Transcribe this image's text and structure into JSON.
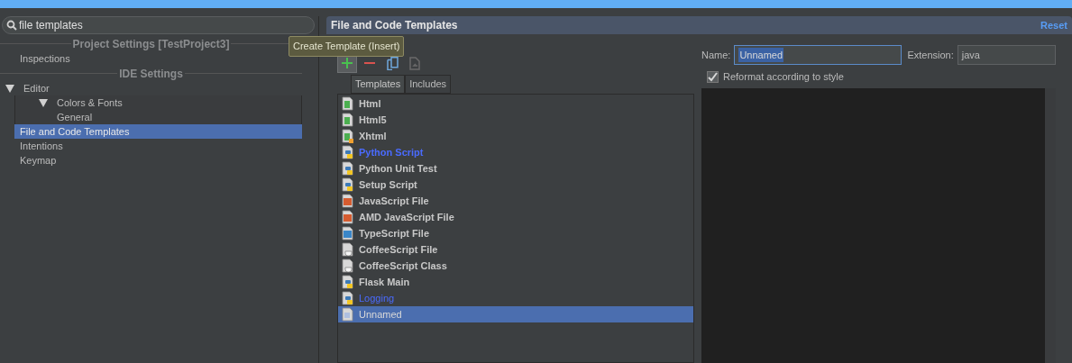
{
  "sidebar": {
    "search": {
      "value": "file templates"
    },
    "sections": [
      {
        "title": "Project Settings [TestProject3]",
        "items": [
          {
            "label": "Inspections",
            "selected": false
          }
        ]
      },
      {
        "title": "IDE Settings",
        "items": [
          {
            "label": "Editor",
            "selected": false,
            "expanded": true,
            "children": [
              {
                "label": "Colors & Fonts",
                "selected": false,
                "expanded": true,
                "children": [
                  {
                    "label": "General",
                    "selected": false
                  }
                ]
              }
            ]
          },
          {
            "label": "File and Code Templates",
            "selected": true
          },
          {
            "label": "Intentions",
            "selected": false
          },
          {
            "label": "Keymap",
            "selected": false
          }
        ]
      }
    ]
  },
  "panel": {
    "title": "File and Code Templates",
    "reset": "Reset",
    "tooltip": "Create Template (Insert)",
    "toolbar": [
      {
        "kind": "add",
        "disabled": false
      },
      {
        "kind": "remove",
        "disabled": false
      },
      {
        "kind": "copy",
        "disabled": false
      },
      {
        "kind": "revert",
        "disabled": true
      }
    ],
    "tabs": [
      {
        "label": "Templates",
        "selected": true
      },
      {
        "label": "Includes",
        "selected": false
      }
    ],
    "templates": [
      {
        "label": "Html",
        "kind": "html",
        "builtin": true,
        "modified": false,
        "selected": false
      },
      {
        "label": "Html5",
        "kind": "html",
        "builtin": true,
        "modified": false,
        "selected": false
      },
      {
        "label": "Xhtml",
        "kind": "xhtml",
        "builtin": true,
        "modified": false,
        "selected": false
      },
      {
        "label": "Python Script",
        "kind": "python",
        "builtin": true,
        "modified": true,
        "selected": false
      },
      {
        "label": "Python Unit Test",
        "kind": "python",
        "builtin": true,
        "modified": false,
        "selected": false
      },
      {
        "label": "Setup Script",
        "kind": "python",
        "builtin": true,
        "modified": false,
        "selected": false
      },
      {
        "label": "JavaScript File",
        "kind": "js",
        "builtin": true,
        "modified": false,
        "selected": false
      },
      {
        "label": "AMD JavaScript File",
        "kind": "js",
        "builtin": true,
        "modified": false,
        "selected": false
      },
      {
        "label": "TypeScript File",
        "kind": "ts",
        "builtin": true,
        "modified": false,
        "selected": false
      },
      {
        "label": "CoffeeScript File",
        "kind": "coffee",
        "builtin": true,
        "modified": false,
        "selected": false
      },
      {
        "label": "CoffeeScript Class",
        "kind": "coffee",
        "builtin": true,
        "modified": false,
        "selected": false
      },
      {
        "label": "Flask Main",
        "kind": "python",
        "builtin": true,
        "modified": false,
        "selected": false
      },
      {
        "label": "Logging",
        "kind": "python",
        "builtin": false,
        "modified": true,
        "selected": false
      },
      {
        "label": "Unnamed",
        "kind": "blank",
        "builtin": false,
        "modified": false,
        "selected": true
      }
    ],
    "name_label": "Name:",
    "name_value": "Unnamed",
    "extension_label": "Extension:",
    "extension_value": "java",
    "reformat": {
      "label": "Reformat according to style",
      "checked": true
    }
  }
}
